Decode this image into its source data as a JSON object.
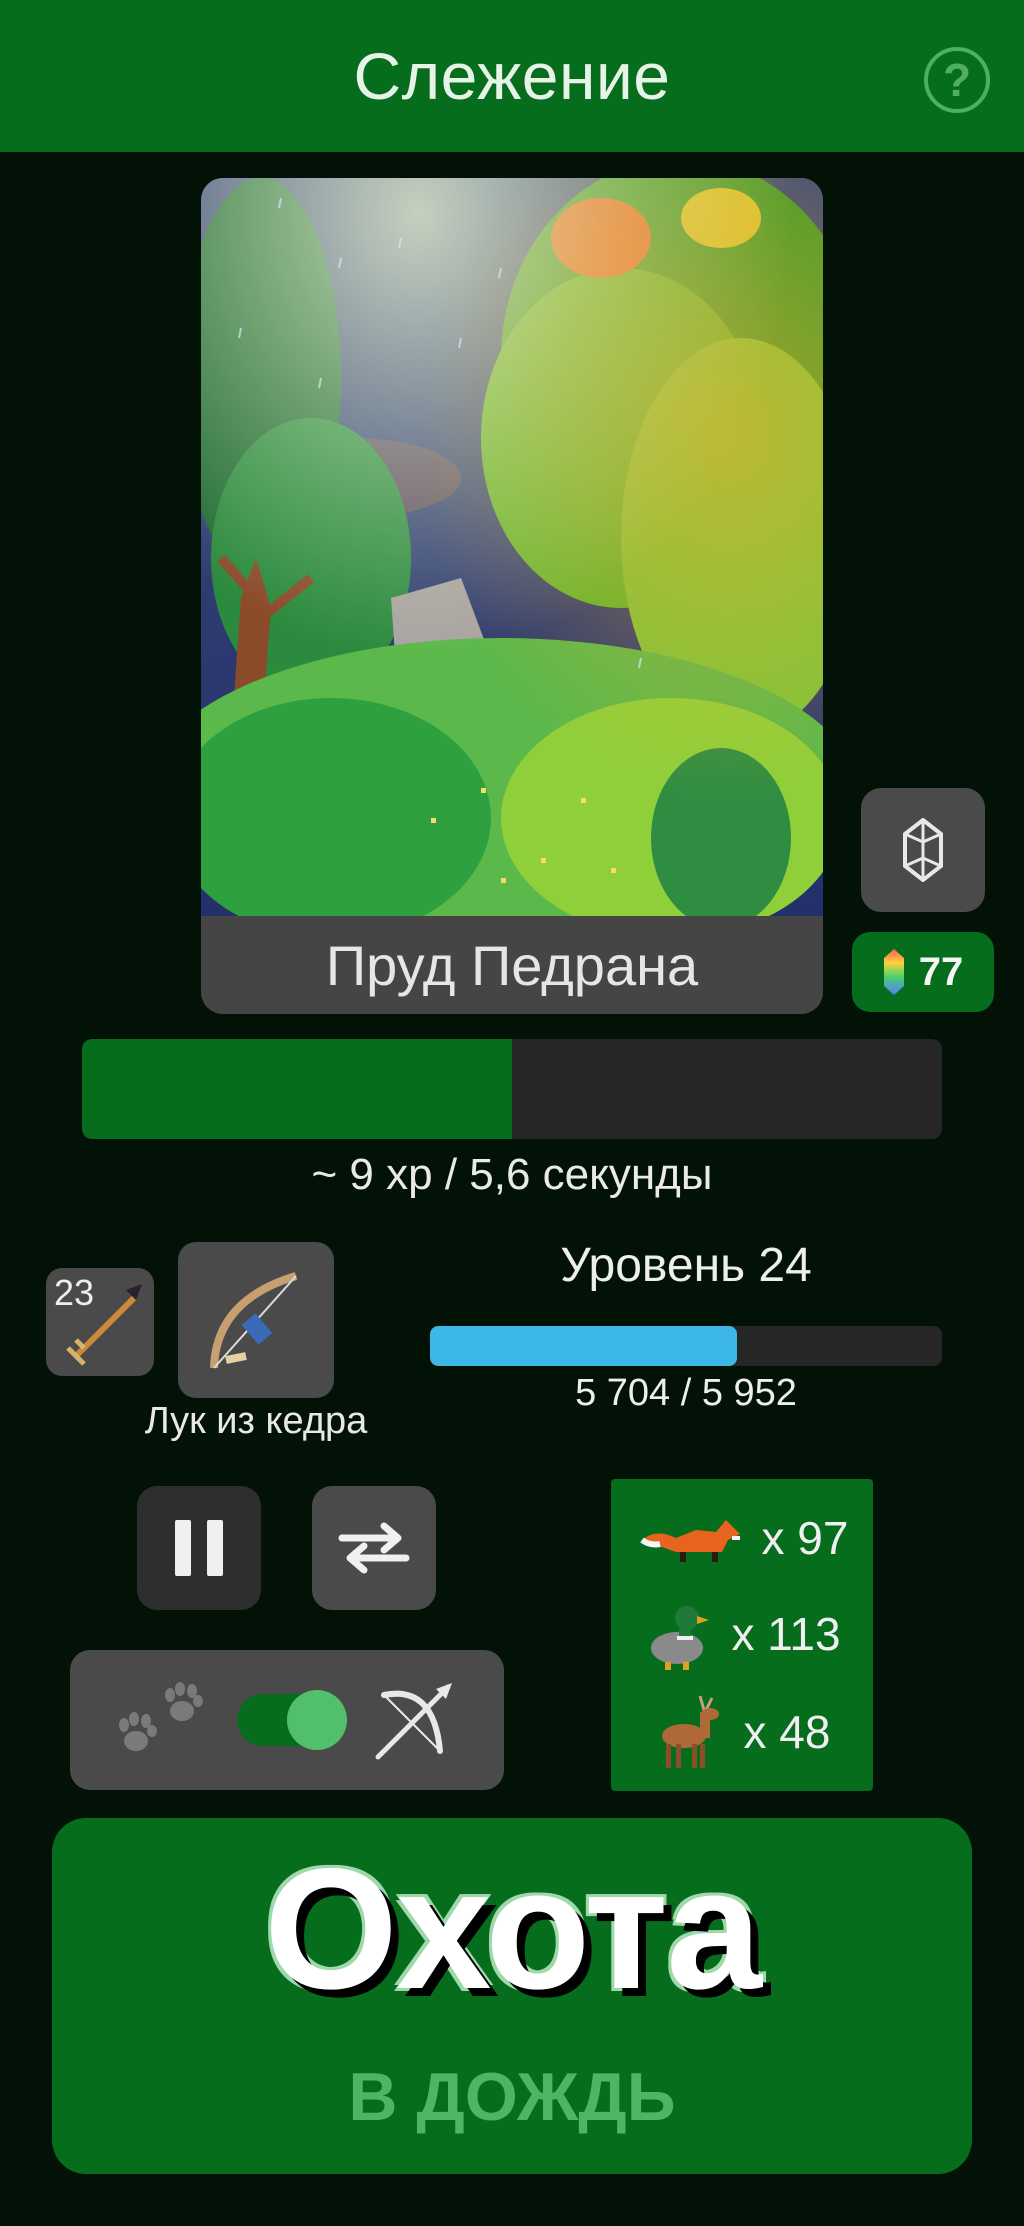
{
  "header": {
    "title": "Слежение",
    "help_icon": "question-circle-icon",
    "help_label": "?"
  },
  "location": {
    "name": "Пруд Педрана",
    "weather": "rain",
    "art": "pixel-forest-rain-scene"
  },
  "currency": {
    "icon": "crystal-icon",
    "gem_icon": "rainbow-gem-icon",
    "count": "77"
  },
  "tracking": {
    "progress_fraction": 0.5,
    "rate_text": "~ 9 xp / 5,6 секунды"
  },
  "equipment": {
    "ammo_icon": "arrow-icon",
    "ammo_count": "23",
    "weapon_icon": "cedar-bow-icon",
    "weapon_name": "Лук из кедра"
  },
  "level": {
    "title": "Уровень 24",
    "xp_text": "5 704 / 5 952",
    "progress_fraction": 0.6
  },
  "controls": {
    "pause_icon": "pause-icon",
    "swap_icon": "swap-arrows-icon",
    "mode_left_icon": "paw-prints-icon",
    "mode_right_icon": "bow-arrow-icon",
    "toggle_on": true
  },
  "catches": [
    {
      "icon": "fox-icon",
      "count": "x 97"
    },
    {
      "icon": "duck-icon",
      "count": "x 113"
    },
    {
      "icon": "deer-icon",
      "count": "x 48"
    }
  ],
  "hunt_button": {
    "title": "Охота",
    "subtitle": "в дождь"
  },
  "colors": {
    "background": "#021207",
    "brand_green": "#066d1d",
    "panel_gray": "#4a4a4a",
    "xp_blue": "#3db8e6",
    "accent_light_green": "#4fb563"
  }
}
